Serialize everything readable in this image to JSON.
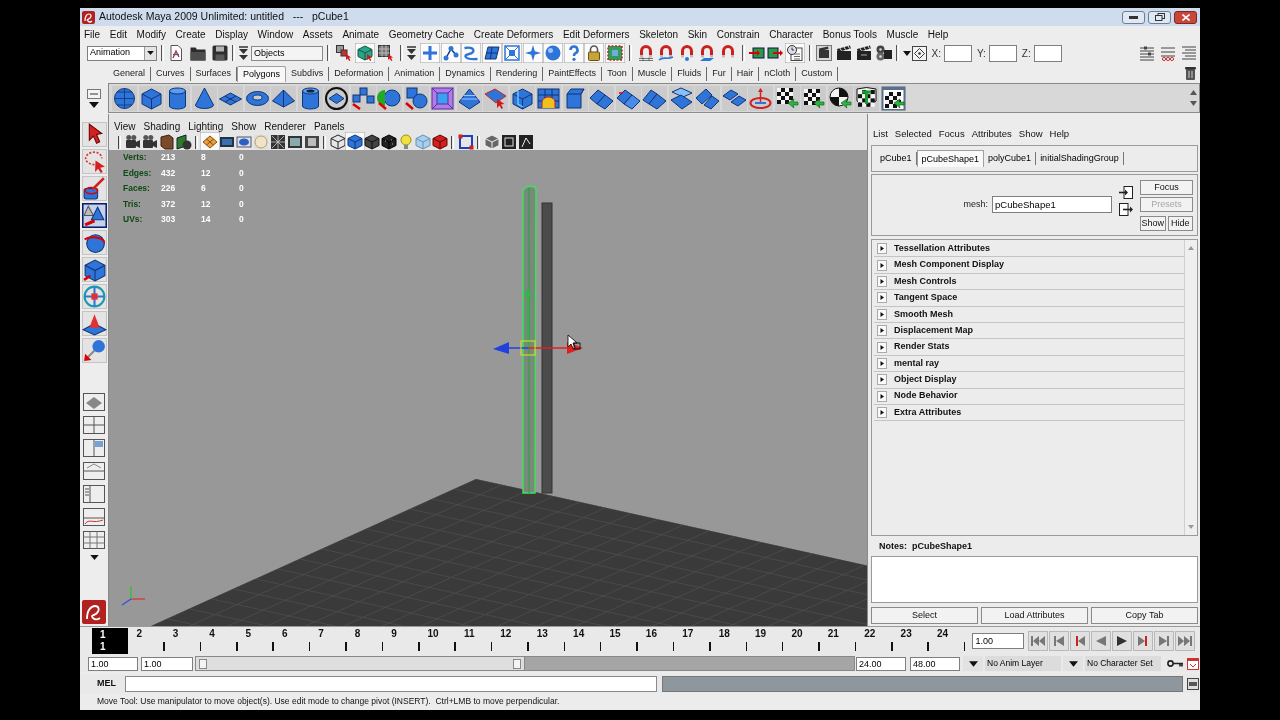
{
  "window": {
    "title": "Autodesk Maya 2009 Unlimited: untitled   ---   pCube1"
  },
  "menu_bar": [
    "File",
    "Edit",
    "Modify",
    "Create",
    "Display",
    "Window",
    "Assets",
    "Animate",
    "Geometry Cache",
    "Create Deformers",
    "Edit Deformers",
    "Skeleton",
    "Skin",
    "Constrain",
    "Character",
    "Bonus Tools",
    "Muscle",
    "Help"
  ],
  "status_line": {
    "menu_set": "Animation",
    "selection_mode": "Objects",
    "select_tools": [
      {
        "kind": "hierarchy",
        "on": false
      },
      {
        "kind": "object",
        "on": true
      },
      {
        "kind": "component",
        "on": false
      }
    ],
    "mask_tools": [
      {
        "kind": "handle",
        "on": true
      },
      {
        "kind": "joint",
        "on": true
      },
      {
        "kind": "curve",
        "on": true
      },
      {
        "kind": "surface",
        "on": true
      },
      {
        "kind": "deformer",
        "on": true
      },
      {
        "kind": "dynamic",
        "on": true
      },
      {
        "kind": "render",
        "on": true
      },
      {
        "kind": "misc",
        "on": true
      },
      {
        "kind": "lock",
        "on": true
      },
      {
        "kind": "marquee",
        "on": true
      }
    ],
    "snap_tools": [
      {
        "kind": "grid",
        "on": false
      },
      {
        "kind": "curve",
        "on": false
      },
      {
        "kind": "point",
        "on": false
      },
      {
        "kind": "plane",
        "on": false
      },
      {
        "kind": "live",
        "on": false
      }
    ],
    "history": {
      "on": true
    },
    "coordinate_fields": [
      {
        "label": "X:"
      },
      {
        "label": "Y:"
      },
      {
        "label": "Z:"
      }
    ]
  },
  "shelf": {
    "tabs": [
      {
        "label": "General",
        "selected": false
      },
      {
        "label": "Curves",
        "selected": false
      },
      {
        "label": "Surfaces",
        "selected": false
      },
      {
        "label": "Polygons",
        "selected": true
      },
      {
        "label": "Subdivs",
        "selected": false
      },
      {
        "label": "Deformation",
        "selected": false
      },
      {
        "label": "Animation",
        "selected": false
      },
      {
        "label": "Dynamics",
        "selected": false
      },
      {
        "label": "Rendering",
        "selected": false
      },
      {
        "label": "PaintEffects",
        "selected": false
      },
      {
        "label": "Toon",
        "selected": false
      },
      {
        "label": "Muscle",
        "selected": false
      },
      {
        "label": "Fluids",
        "selected": false
      },
      {
        "label": "Fur",
        "selected": false
      },
      {
        "label": "Hair",
        "selected": false
      },
      {
        "label": "nCloth",
        "selected": false
      },
      {
        "label": "Custom",
        "selected": false
      }
    ]
  },
  "toolbox": {
    "tools": [
      {
        "kind": "select",
        "selected": false
      },
      {
        "kind": "lasso",
        "selected": false
      },
      {
        "kind": "paint",
        "selected": false
      },
      {
        "kind": "move",
        "selected": true
      },
      {
        "kind": "rotate",
        "selected": false
      },
      {
        "kind": "scale",
        "selected": false
      },
      {
        "kind": "universal",
        "selected": false
      },
      {
        "kind": "soft",
        "selected": false
      },
      {
        "kind": "manip",
        "selected": false
      }
    ]
  },
  "viewport": {
    "menu": [
      "View",
      "Shading",
      "Lighting",
      "Show",
      "Renderer",
      "Panels"
    ],
    "toolbar": [
      {
        "kind": "camera",
        "on": false
      },
      {
        "kind": "camera",
        "on": false
      },
      {
        "kind": "bookmark",
        "on": false
      },
      {
        "kind": "imageplane",
        "on": false
      },
      {
        "kind": "grid",
        "on": true
      },
      {
        "kind": "filmgate",
        "on": false
      },
      {
        "kind": "resgate",
        "on": false
      },
      {
        "kind": "safe",
        "on": false
      },
      {
        "kind": "wiregrid",
        "on": false
      },
      {
        "kind": "picture",
        "on": false
      },
      {
        "kind": "gatemask",
        "on": false
      },
      {
        "kind": "wireframe",
        "on": false
      },
      {
        "kind": "shaded",
        "on": true
      },
      {
        "kind": "smooth",
        "on": false
      },
      {
        "kind": "textured",
        "on": false
      },
      {
        "kind": "lights",
        "on": false
      },
      {
        "kind": "palecube",
        "on": false
      },
      {
        "kind": "redcube",
        "on": false
      },
      {
        "kind": "isolate",
        "on": false
      },
      {
        "kind": "xray",
        "on": false
      },
      {
        "kind": "frame",
        "on": false
      },
      {
        "kind": "jointxray",
        "on": false
      }
    ],
    "hud": [
      {
        "label": "Verts:",
        "values": [
          "213",
          "8",
          "0"
        ]
      },
      {
        "label": "Edges:",
        "values": [
          "432",
          "12",
          "0"
        ]
      },
      {
        "label": "Faces:",
        "values": [
          "226",
          "6",
          "0"
        ]
      },
      {
        "label": "Tris:",
        "values": [
          "372",
          "12",
          "0"
        ]
      },
      {
        "label": "UVs:",
        "values": [
          "303",
          "14",
          "0"
        ]
      }
    ]
  },
  "attribute_editor": {
    "menu": [
      "List",
      "Selected",
      "Focus",
      "Attributes",
      "Show",
      "Help"
    ],
    "tabs": [
      {
        "label": "pCube1",
        "selected": false
      },
      {
        "label": "pCubeShape1",
        "selected": true
      },
      {
        "label": "polyCube1",
        "selected": false
      },
      {
        "label": "initialShadingGroup",
        "selected": false
      }
    ],
    "node_label": "mesh:",
    "node_name": "pCubeShape1",
    "buttons": [
      {
        "label": "Focus",
        "disabled": false
      },
      {
        "label": "Presets",
        "disabled": true
      },
      {
        "label": "Show",
        "disabled": false
      },
      {
        "label": "Hide",
        "disabled": false
      }
    ],
    "sections": [
      {
        "label": "Tessellation Attributes",
        "expanded": false
      },
      {
        "label": "Mesh Component Display",
        "expanded": false
      },
      {
        "label": "Mesh Controls",
        "expanded": false
      },
      {
        "label": "Tangent Space",
        "expanded": false
      },
      {
        "label": "Smooth Mesh",
        "expanded": false
      },
      {
        "label": "Displacement Map",
        "expanded": false
      },
      {
        "label": "Render Stats",
        "expanded": false
      },
      {
        "label": "mental ray",
        "expanded": false
      },
      {
        "label": "Object Display",
        "expanded": false
      },
      {
        "label": "Node Behavior",
        "expanded": false
      },
      {
        "label": "Extra Attributes",
        "expanded": false
      }
    ],
    "notes_label": "Notes:  pCubeShape1",
    "footer_buttons": [
      "Select",
      "Load Attributes",
      "Copy Tab"
    ]
  },
  "time_slider": {
    "frames": [
      {
        "label": "1",
        "current": true
      },
      {
        "label": "2",
        "current": false
      },
      {
        "label": "3",
        "current": false
      },
      {
        "label": "4",
        "current": false
      },
      {
        "label": "5",
        "current": false
      },
      {
        "label": "6",
        "current": false
      },
      {
        "label": "7",
        "current": false
      },
      {
        "label": "8",
        "current": false
      },
      {
        "label": "9",
        "current": false
      },
      {
        "label": "10",
        "current": false
      },
      {
        "label": "11",
        "current": false
      },
      {
        "label": "12",
        "current": false
      },
      {
        "label": "13",
        "current": false
      },
      {
        "label": "14",
        "current": false
      },
      {
        "label": "15",
        "current": false
      },
      {
        "label": "16",
        "current": false
      },
      {
        "label": "17",
        "current": false
      },
      {
        "label": "18",
        "current": false
      },
      {
        "label": "19",
        "current": false
      },
      {
        "label": "20",
        "current": false
      },
      {
        "label": "21",
        "current": false
      },
      {
        "label": "22",
        "current": false
      },
      {
        "label": "23",
        "current": false
      },
      {
        "label": "24",
        "current": false
      }
    ],
    "current_time": "1",
    "current_time_field": "1.00"
  },
  "range_slider": {
    "start_time": "1.00",
    "range_start": "1.00",
    "level": 0.5,
    "range_end": "24.00",
    "end_time": "48.00",
    "anim_layer": "No Anim Layer",
    "character_set": "No Character Set"
  },
  "command_line": {
    "language": "MEL"
  },
  "help_line": "Move Tool: Use manipulator to move object(s). Use edit mode to change pivot (INSERT).  Ctrl+LMB to move perpendicular."
}
